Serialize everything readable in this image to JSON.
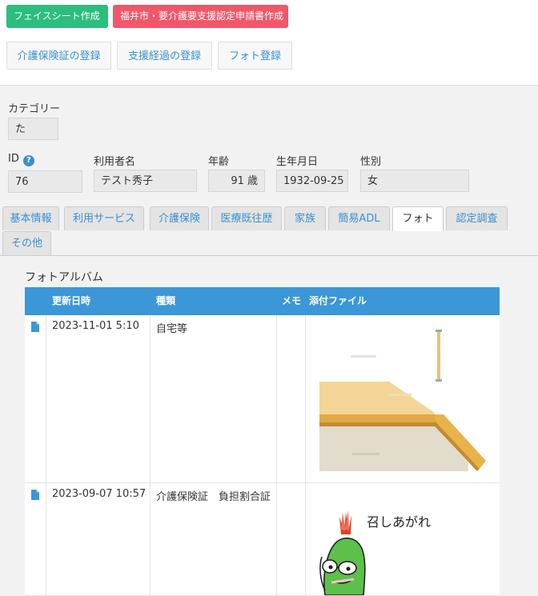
{
  "top_buttons": {
    "facesheet": "フェイスシート作成",
    "fukui": "福井市・要介護要支援認定申請書作成"
  },
  "action_buttons": {
    "insurance": "介護保険証の登録",
    "support": "支援経過の登録",
    "photo": "フォト登録"
  },
  "profile": {
    "category_label": "カテゴリー",
    "category_value": "た",
    "id_label": "ID",
    "id_value": "76",
    "name_label": "利用者名",
    "name_value": "テスト秀子",
    "age_label": "年齢",
    "age_value": "91 歳",
    "birth_label": "生年月日",
    "birth_value": "1932-09-25",
    "gender_label": "性別",
    "gender_value": "女"
  },
  "tabs": [
    "基本情報",
    "利用サービス",
    "介護保険",
    "医療既往歴",
    "家族",
    "簡易ADL",
    "フォト",
    "認定調査",
    "その他"
  ],
  "active_tab": "フォト",
  "album": {
    "title": "フォトアルバム",
    "headers": {
      "updated": "更新日時",
      "type": "種類",
      "memo": "メモ",
      "attachment": "添付ファイル"
    },
    "rows": [
      {
        "updated": "2023-11-01 5:10",
        "type": "自宅等",
        "memo": "",
        "attachment_caption": ""
      },
      {
        "updated": "2023-09-07 10:57",
        "type": "介護保険証　負担割合証",
        "memo": "",
        "attachment_caption": "召しあがれ"
      }
    ]
  },
  "colors": {
    "green": "#2dbd7e",
    "red": "#f0576b",
    "blue_header": "#3b97d8",
    "link_blue": "#3a8fd0"
  }
}
